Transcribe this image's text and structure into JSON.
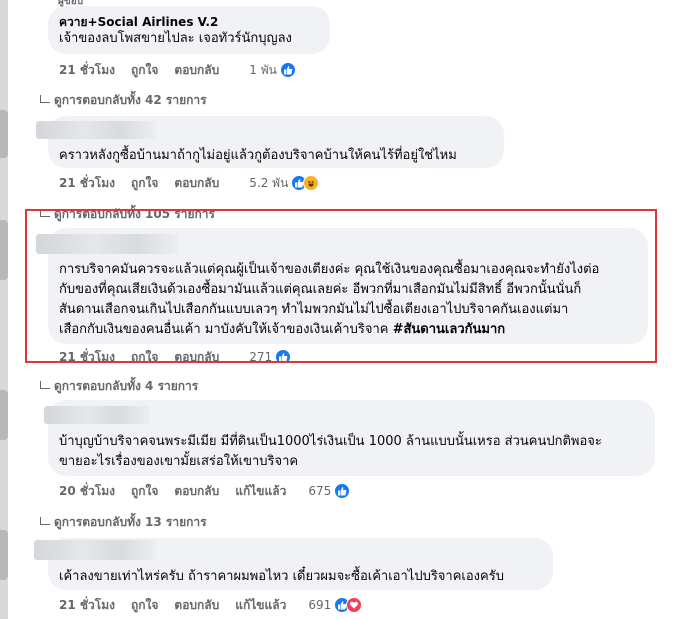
{
  "comments": [
    {
      "author": "ควาย+Social Airlines V.2",
      "text_lines": [
        "เจ้าของลบโพสขายไปละ เจอทัวร์นักบุญลง"
      ],
      "time": "21 ชั่วโมง",
      "like": "ถูกใจ",
      "reply": "ตอบกลับ",
      "edited": "",
      "reaction_count": "1 พัน",
      "reactions": [
        "like"
      ],
      "replies_label": "ดูการตอบกลับทั้ง 42 รายการ"
    },
    {
      "author": "",
      "text_lines": [
        "คราวหลังกูซื้อบ้านมาถ้ากูไม่อยู่แล้วกูต้องบริจาคบ้านให้คนไร้ที่อยู่ใช่ไหม"
      ],
      "time": "21 ชั่วโมง",
      "like": "ถูกใจ",
      "reply": "ตอบกลับ",
      "edited": "",
      "reaction_count": "5.2 พัน",
      "reactions": [
        "like",
        "haha"
      ],
      "replies_label": "ดูการตอบกลับทั้ง 105 รายการ"
    },
    {
      "author": "",
      "text_lines": [
        "การบริจาคมันควรจะแล้วแต่คุณผู้เป็นเจ้าของเตียงค่ะ คุณใช้เงินของคุณซื้อมาเองคุณจะทำยังไงต่อ",
        "กับของที่คุณเสียเงินด้วเองซื้อมามันแล้วแต่คุณเลยค่ะ อีพวกที่มาเสือกมันไม่มีสิทธิ์ อีพวกนั้นนั่นก็",
        "สันดานเสือกจนเกินไปเสือกกันแบบเลวๆ ทำไมพวกมันไม่ไปซื้อเตียงเอาไปบริจาคกันเองแต่มา",
        "เสือกกับเงินของคนอื่นเค้า มาบังคับให้เจ้าของเงินเค้าบริจาค "
      ],
      "hashtag": "#สันดานเลวกันมาก",
      "time": "21 ชั่วโมง",
      "like": "ถูกใจ",
      "reply": "ตอบกลับ",
      "edited": "",
      "reaction_count": "271",
      "reactions": [
        "like"
      ],
      "replies_label": "ดูการตอบกลับทั้ง 4 รายการ"
    },
    {
      "author": "",
      "text_lines": [
        "บ้าบุญบ้าบริจาคจนพระมีเมีย มีที่ดินเป็น1000ไร่เงินเป็น 1000 ล้านแบบนั้นเหรอ ส่วนคนปกติพอจะ",
        "ขายอะไรเรื่องของเขามั้ยเสร่อให้เขาบริจาค"
      ],
      "time": "20 ชั่วโมง",
      "like": "ถูกใจ",
      "reply": "ตอบกลับ",
      "edited": "แก้ไขแล้ว",
      "reaction_count": "675",
      "reactions": [
        "like"
      ],
      "replies_label": "ดูการตอบกลับทั้ง 13 รายการ"
    },
    {
      "author": "",
      "text_lines": [
        "เค้าลงขายเท่าไหร่ครับ ถ้าราคาผมพอไหว เดี๋ยวผมจะซื้อเค้าเอาไปบริจาคเองครับ"
      ],
      "time": "21 ชั่วโมง",
      "like": "ถูกใจ",
      "reply": "ตอบกลับ",
      "edited": "แก้ไขแล้ว",
      "reaction_count": "691",
      "reactions": [
        "like",
        "love"
      ],
      "replies_label": ""
    }
  ],
  "top_partial_label": "ผู้ขอบ",
  "colors": {
    "highlight": "#e0353a",
    "like": "#1877f2",
    "haha": "#f7b125",
    "love": "#f33e58",
    "bubble": "#f0f2f5",
    "meta": "#65676b"
  },
  "icons": [
    "thumbs-up-icon",
    "haha-face-icon",
    "heart-icon",
    "reply-arrow-icon"
  ]
}
